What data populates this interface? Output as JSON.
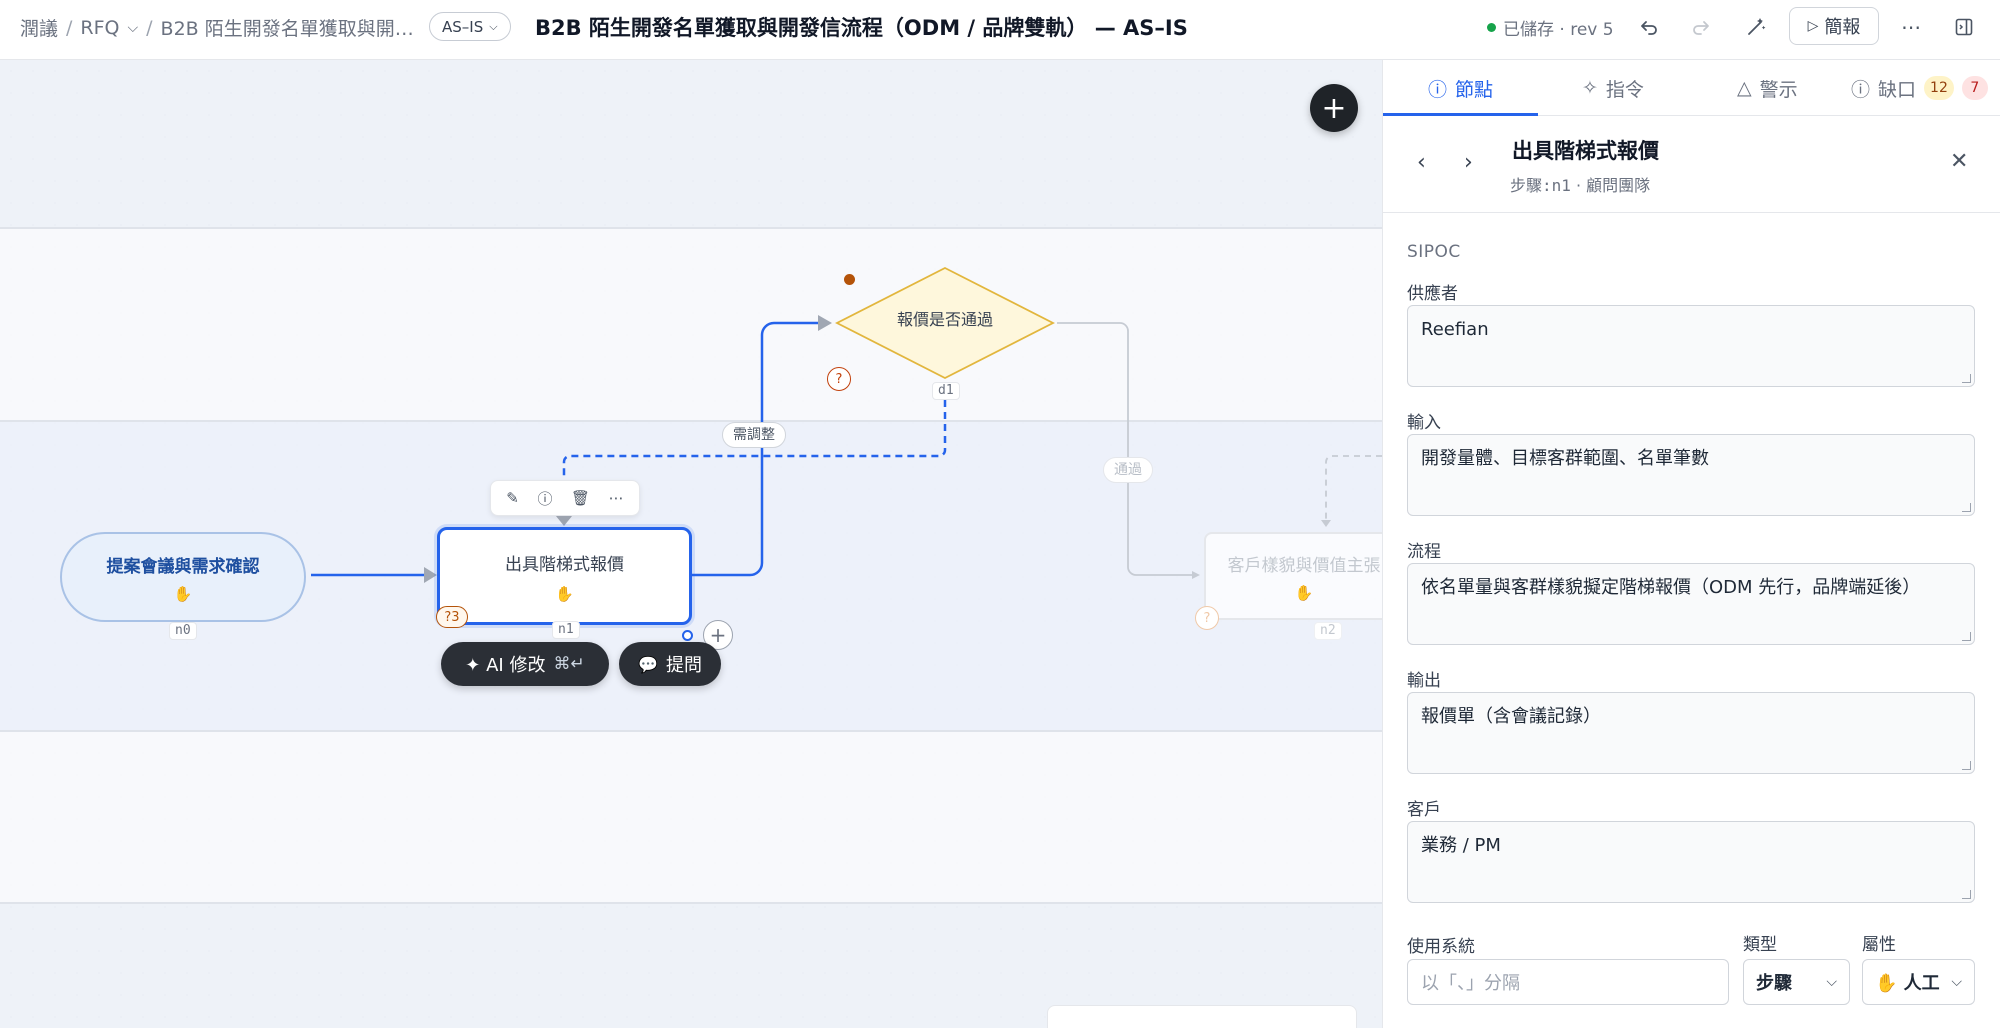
{
  "header": {
    "breadcrumb": [
      "潤議",
      "RFQ",
      "B2B 陌生開發名單獲取與開…"
    ],
    "status_pill": "AS–IS",
    "title": "B2B 陌生開發名單獲取與開發信流程（ODM / 品牌雙軌） — AS–IS",
    "saved": "已儲存 · rev 5",
    "present_label": "簡報"
  },
  "canvas": {
    "nodes": [
      {
        "id": "n0",
        "label": "提案會議與需求確認",
        "icon": "hand-icon",
        "shape": "terminal"
      },
      {
        "id": "n1",
        "label": "出具階梯式報價",
        "icon": "hand-icon",
        "shape": "process",
        "selected": true,
        "question_count": "?3"
      },
      {
        "id": "d1",
        "label": "報價是否通過",
        "shape": "decision"
      },
      {
        "id": "n2",
        "label": "客戶樣貌與價值主張",
        "icon": "hand-icon",
        "shape": "process",
        "faded": true
      }
    ],
    "edge_labels": {
      "adjust": "需調整",
      "pass": "通過"
    },
    "ai_button": {
      "label": "✦ AI 修改",
      "shortcut": "⌘↵"
    },
    "ask_button": {
      "label": "提問"
    },
    "node_toolbar": [
      "edit-icon",
      "info-icon",
      "trash-icon",
      "more-icon"
    ]
  },
  "panel": {
    "tabs": [
      {
        "label": "節點",
        "icon": "info-icon",
        "active": true
      },
      {
        "label": "指令",
        "icon": "sparkle-icon"
      },
      {
        "label": "警示",
        "icon": "warning-icon"
      },
      {
        "label": "缺口",
        "icon": "question-icon",
        "badge_warn": "12",
        "badge_err": "7"
      }
    ],
    "node_title": "出具階梯式報價",
    "node_sub_step": "步驟:n1",
    "node_sub_owner": "顧問團隊",
    "section_label": "SIPOC",
    "fields": [
      {
        "label": "供應者",
        "value": "Reefian"
      },
      {
        "label": "輸入",
        "value": "開發量體、目標客群範圍、名單筆數"
      },
      {
        "label": "流程",
        "value": "依名單量與客群樣貌擬定階梯報價（ODM 先行，品牌端延後）"
      },
      {
        "label": "輸出",
        "value": "報價單（含會議記錄）"
      },
      {
        "label": "客戶",
        "value": "業務 / PM"
      }
    ],
    "systems_label": "使用系統",
    "systems_placeholder": "以「、」分隔",
    "type_label": "類型",
    "type_value": "步驟",
    "attr_label": "屬性",
    "attr_value": "✋ 人工"
  },
  "colors": {
    "accent": "#2563eb",
    "decision_fill": "#fef7dc",
    "decision_stroke": "#e2b63d",
    "warn": "#c2410c"
  }
}
